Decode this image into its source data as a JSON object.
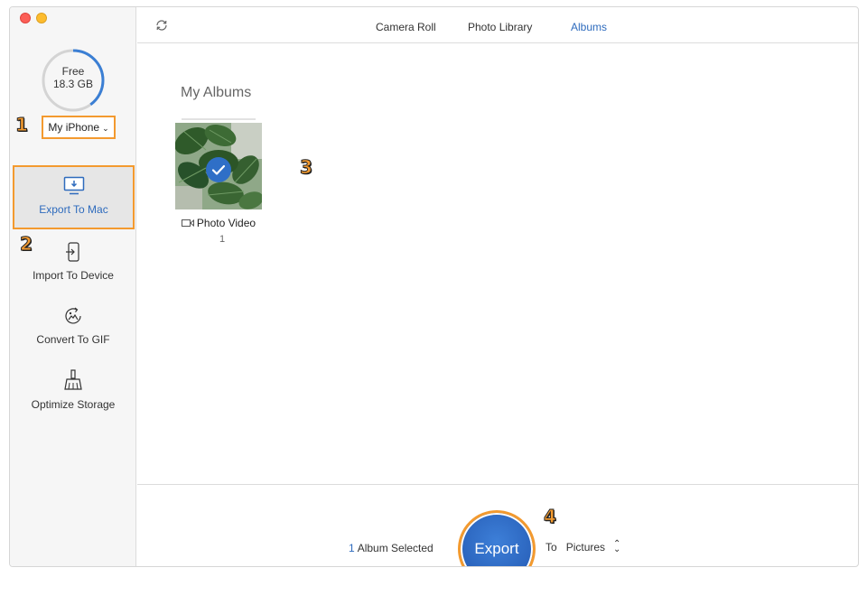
{
  "sidebar": {
    "storage": {
      "free_label": "Free",
      "free_value": "18.3 GB",
      "used_fraction": 0.4
    },
    "device": {
      "name": "My iPhone"
    },
    "items": [
      {
        "label": "Export To Mac",
        "icon": "monitor-download-icon"
      },
      {
        "label": "Import To Device",
        "icon": "phone-import-icon"
      },
      {
        "label": "Convert To GIF",
        "icon": "gif-convert-icon"
      },
      {
        "label": "Optimize Storage",
        "icon": "broom-icon"
      }
    ]
  },
  "tabs": [
    {
      "label": "Camera Roll"
    },
    {
      "label": "Photo Library"
    },
    {
      "label": "Albums"
    }
  ],
  "active_tab": "Albums",
  "content": {
    "section_title": "My Albums",
    "albums": [
      {
        "name": "Photo Video",
        "count": "1",
        "selected": true
      }
    ]
  },
  "footer": {
    "selected_count": "1",
    "selected_label": "Album Selected",
    "export_label": "Export",
    "to_label": "To",
    "destination": "Pictures"
  },
  "annotations": [
    "1",
    "2",
    "3",
    "4"
  ],
  "colors": {
    "accent": "#2e6bbd",
    "highlight": "#f39a2f"
  }
}
